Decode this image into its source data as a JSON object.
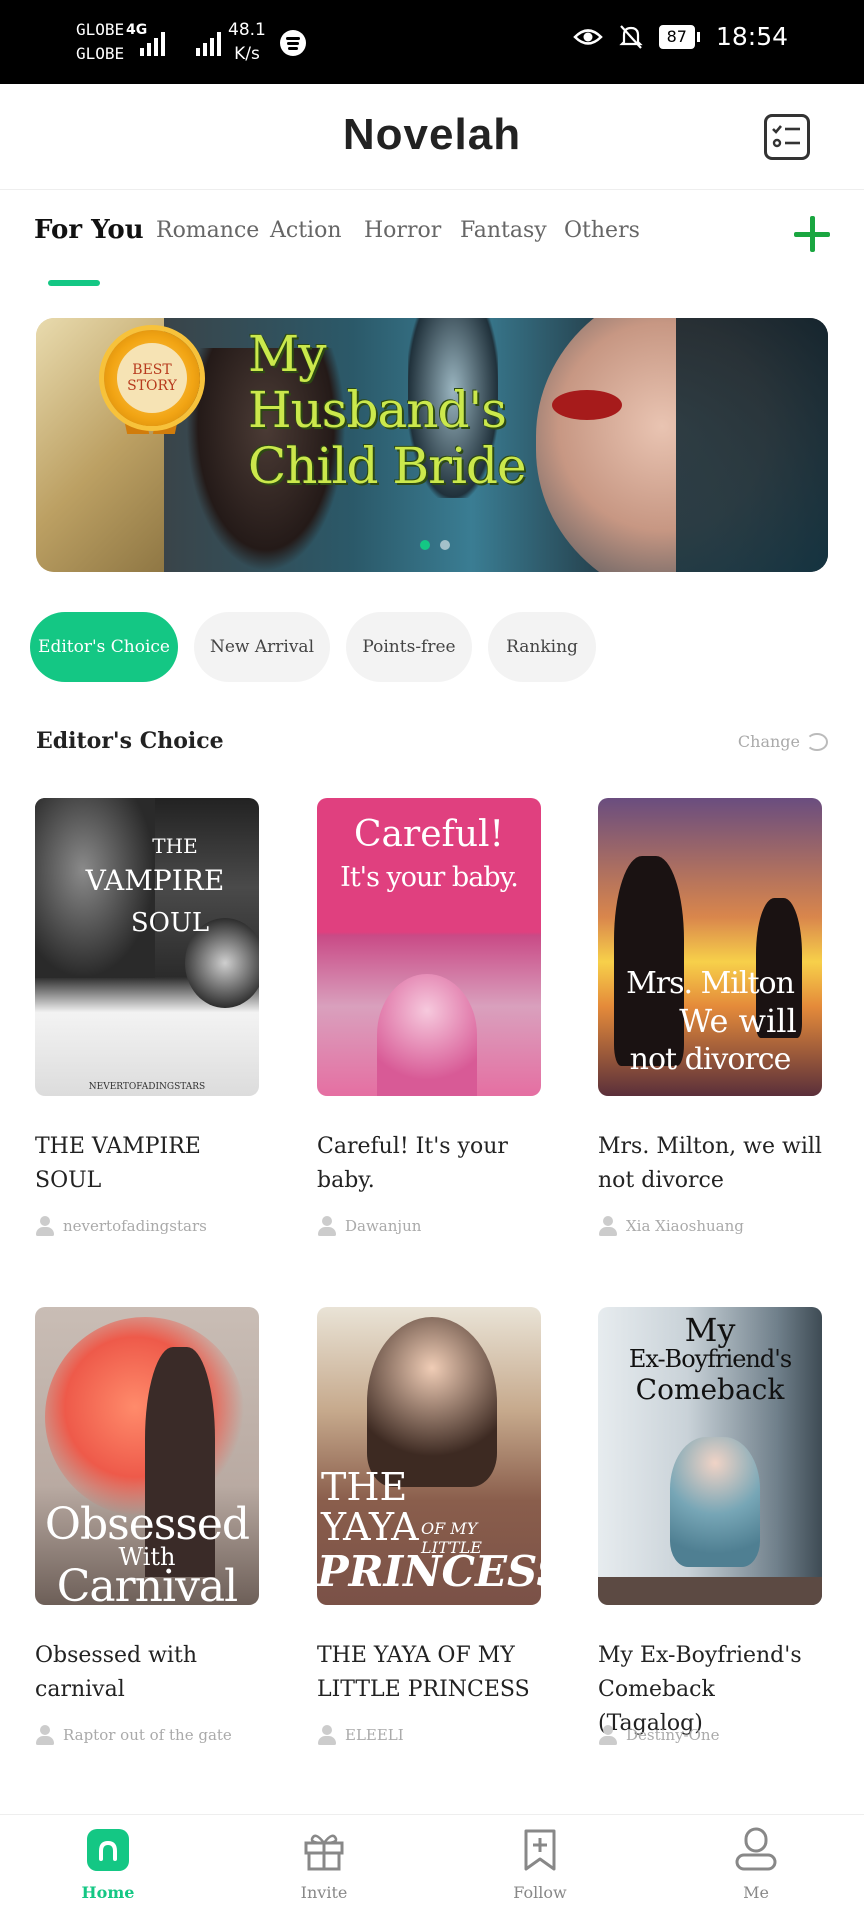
{
  "status_bar": {
    "carrier_top": "GLOBE",
    "carrier_bottom": "GLOBE",
    "network_type": "4G",
    "speed_value": "48.1",
    "speed_unit": "K/s",
    "battery": "87",
    "time": "18:54"
  },
  "header": {
    "title": "Novelah",
    "checklist_icon": "checklist-icon"
  },
  "tabs": [
    "For You",
    "Romance",
    "Action",
    "Horror",
    "Fantasy",
    "Others"
  ],
  "active_tab": "For You",
  "banner": {
    "badge_line1": "BEST",
    "badge_line2": "STORY",
    "title": "My Husband's Child Bride",
    "slide_index": 1,
    "slide_count": 2
  },
  "chips": [
    "Editor's Choice",
    "New Arrival",
    "Points-free",
    "Ranking"
  ],
  "active_chip": "Editor's Choice",
  "section": {
    "title": "Editor's Choice",
    "change_label": "Change"
  },
  "books": [
    {
      "cover_line1": "THE",
      "cover_line2": "VAMPIRE",
      "cover_line3": "SOUL",
      "cover_credit": "NEVERTOFADINGSTARS",
      "title": "THE VAMPIRE SOUL",
      "author": "nevertofadingstars"
    },
    {
      "cover_line1": "Careful!",
      "cover_line2": "It's your baby.",
      "title": "Careful! It's your baby.",
      "author": "Dawanjun"
    },
    {
      "cover_line1": "Mrs. Milton",
      "cover_line2": "We will",
      "cover_line3": "not divorce",
      "title": "Mrs. Milton, we will not divorce",
      "author": "Xia Xiaoshuang"
    },
    {
      "cover_line1": "Obsessed",
      "cover_line2": "With",
      "cover_line3": "Carnival",
      "title": "Obsessed with carnival",
      "author": "Raptor out of the gate"
    },
    {
      "cover_line1": "THE",
      "cover_line2": "YAYA",
      "cover_line2b": "OF MY LITTLE",
      "cover_line3": "PRINCESS",
      "title": "THE YAYA OF MY LITTLE PRINCESS",
      "author": "ELEELI"
    },
    {
      "cover_line1": "My",
      "cover_line2": "Ex-Boyfriend's",
      "cover_line3": "Comeback",
      "title": "My Ex-Boyfriend's Comeback (Tagalog)",
      "author": "Destiny-One"
    }
  ],
  "bottom_nav": {
    "items": [
      {
        "label": "Home",
        "icon": "home-icon"
      },
      {
        "label": "Invite",
        "icon": "gift-icon"
      },
      {
        "label": "Follow",
        "icon": "bookmark-add-icon"
      },
      {
        "label": "Me",
        "icon": "profile-icon"
      }
    ],
    "active": "Home"
  },
  "colors": {
    "accent": "#14c784",
    "plus": "#1aa640"
  }
}
